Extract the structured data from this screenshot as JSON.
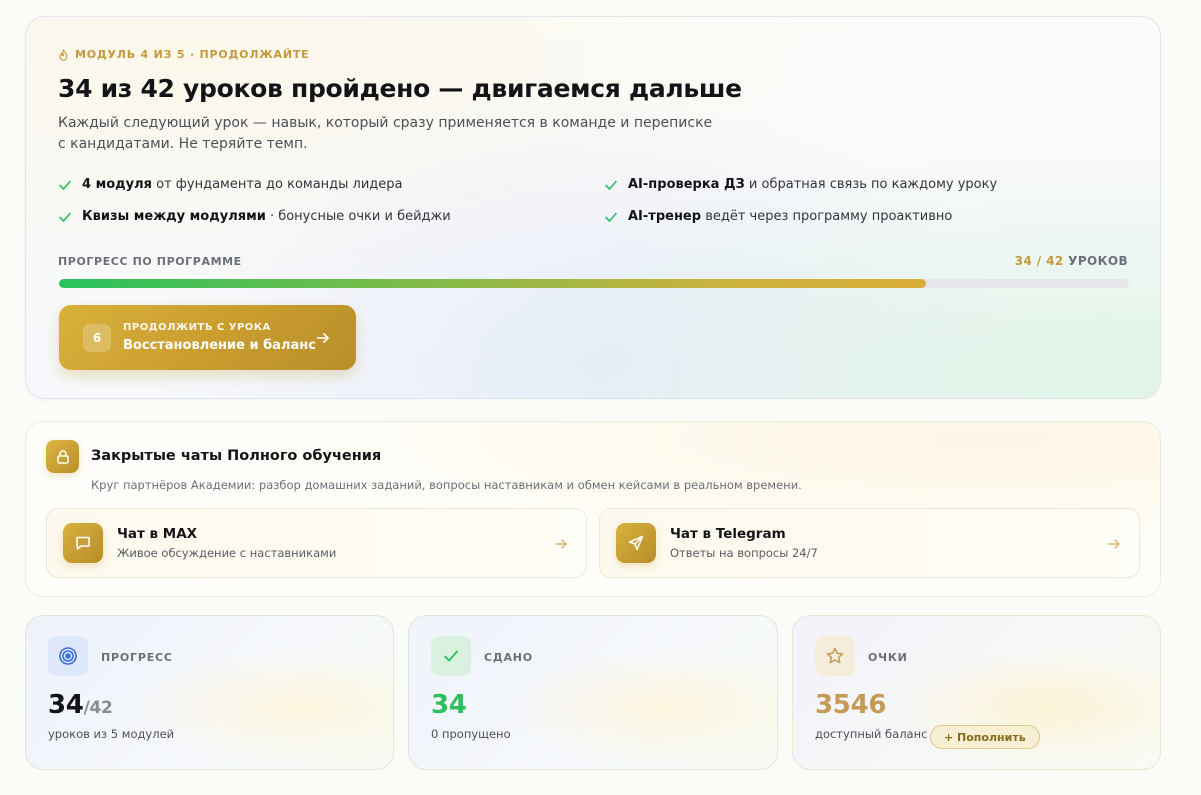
{
  "hero": {
    "eyebrow": "МОДУЛЬ 4 ИЗ 5 · ПРОДОЛЖАЙТЕ",
    "title": "34 из 42 уроков пройдено — двигаемся дальше",
    "subtitle": "Каждый следующий урок — навык, который сразу применяется в команде и переписке с кандидатами. Не теряйте темп.",
    "features": [
      {
        "bold": "4 модуля",
        "rest": " от фундамента до команды лидера"
      },
      {
        "bold": "AI-проверка ДЗ",
        "rest": " и обратная связь по каждому уроку"
      },
      {
        "bold": "Квизы между модулями",
        "rest": " · бонусные очки и бейджи"
      },
      {
        "bold": "AI-тренер",
        "rest": " ведёт через программу проактивно"
      }
    ],
    "progress": {
      "label": "ПРОГРЕСС ПО ПРОГРАММЕ",
      "count": "34 / 42",
      "unit": " УРОКОВ",
      "done": 34,
      "total": 42,
      "fraction": 0.81
    },
    "cta": {
      "number": "6",
      "eyebrow": "ПРОДОЛЖИТЬ С УРОКА",
      "title": "Восстановление и баланс"
    }
  },
  "chats": {
    "title": "Закрытые чаты Полного обучения",
    "subtitle": "Круг партнёров Академии: разбор домашних заданий, вопросы наставникам и обмен кейсами в реальном времени.",
    "items": [
      {
        "title": "Чат в MAX",
        "subtitle": "Живое обсуждение с наставниками",
        "icon": "message-icon"
      },
      {
        "title": "Чат в Telegram",
        "subtitle": "Ответы на вопросы 24/7",
        "icon": "send-icon"
      }
    ]
  },
  "stats": [
    {
      "label": "ПРОГРЕСС",
      "value": "34",
      "of": "/42",
      "sub": "уроков из 5 модулей",
      "icon": "target-icon",
      "color": "#1b1b1f"
    },
    {
      "label": "СДАНО",
      "value": "34",
      "sub": "0 пропущено",
      "icon": "check-icon",
      "color": "#2cbf5b"
    },
    {
      "label": "ОЧКИ",
      "value": "3546",
      "sub": "доступный баланс",
      "button": "+ Пополнить",
      "icon": "star-icon",
      "color": "#c49a55"
    }
  ],
  "colors": {
    "accent_gold": "#c99c2e",
    "success_green": "#2cbf5b"
  }
}
